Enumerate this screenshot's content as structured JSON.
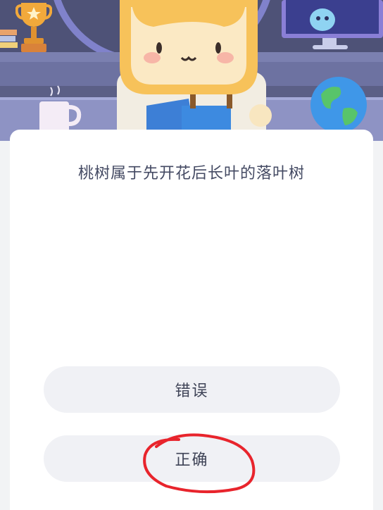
{
  "quiz": {
    "question": "桃树属于先开花后长叶的落叶树",
    "options": [
      {
        "label": "错误"
      },
      {
        "label": "正确"
      }
    ]
  },
  "colors": {
    "scene_bg": "#5b5f86",
    "card_bg": "#ffffff",
    "button_bg": "#f0f1f5",
    "question_text": "#444a63",
    "annotation_red": "#e8242c"
  },
  "icons": [
    "trophy-icon",
    "star-icon",
    "monitor-icon",
    "mug-icon",
    "globe-icon",
    "mascot-illustration"
  ]
}
